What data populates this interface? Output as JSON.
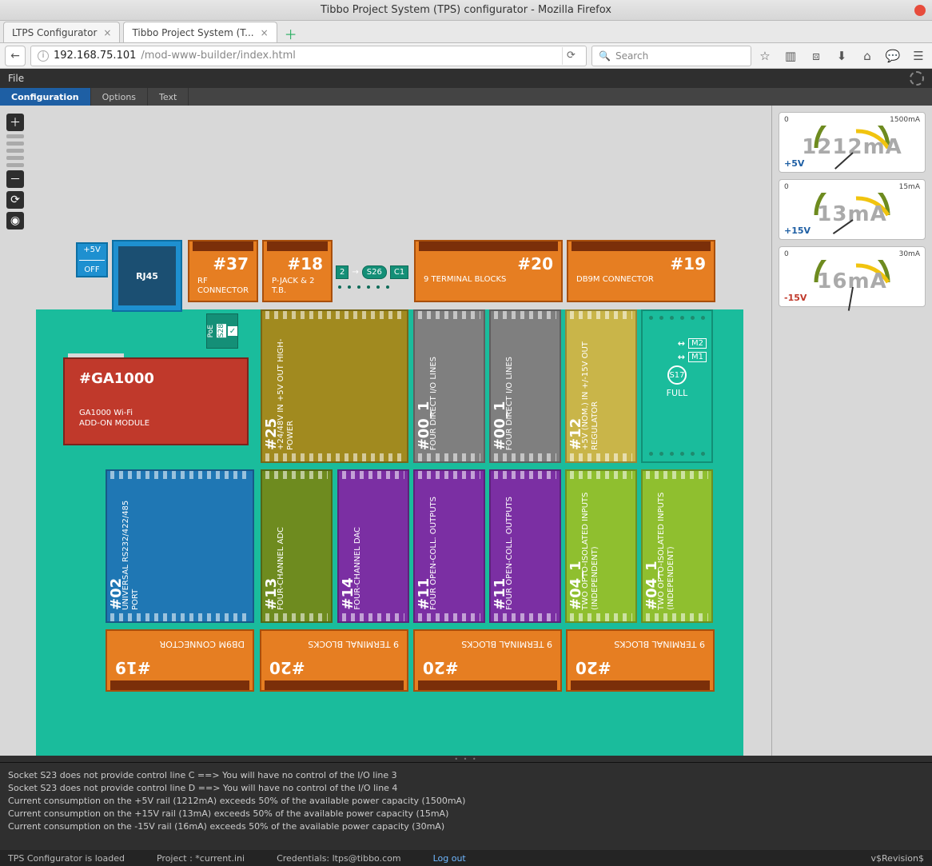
{
  "window": {
    "title": "Tibbo Project System (TPS) configurator - Mozilla Firefox"
  },
  "tabs": [
    {
      "label": "LTPS Configurator"
    },
    {
      "label": "Tibbo Project System (T..."
    }
  ],
  "url": {
    "host": "192.168.75.101",
    "path": "/mod-www-builder/index.html"
  },
  "search": {
    "placeholder": "Search"
  },
  "appmenu": {
    "file": "File"
  },
  "subtabs": {
    "configuration": "Configuration",
    "options": "Options",
    "text": "Text"
  },
  "psu": {
    "top": "+5V",
    "bottom": "OFF"
  },
  "rj45": "RJ45",
  "poe": {
    "label": "PoE",
    "s": "S28"
  },
  "top_conn": {
    "c37": {
      "num": "#37",
      "lbl": "RF CONNECTOR"
    },
    "c18": {
      "num": "#18",
      "lbl": "P-JACK & 2 T.B."
    },
    "c20": {
      "num": "#20",
      "lbl": "9 TERMINAL BLOCKS"
    },
    "c19": {
      "num": "#19",
      "lbl": "DB9M CONNECTOR"
    }
  },
  "mini": {
    "s2": "2",
    "s26": "S26",
    "c1": "C1"
  },
  "ga": {
    "h": "#GA1000",
    "d1": "GA1000 Wi-Fi",
    "d2": "ADD-ON MODULE"
  },
  "mid": {
    "m25": {
      "num": "#25",
      "lbl": "+24/48V IN +5V OUT HIGH-POWER"
    },
    "m00a": {
      "num": "#00_1",
      "lbl": "FOUR DIRECT I/O LINES"
    },
    "m00b": {
      "num": "#00_1",
      "lbl": "FOUR DIRECT I/O LINES"
    },
    "m12": {
      "num": "#12",
      "lbl": "+5V (NOM.) IN +/-15V OUT REGULATOR"
    }
  },
  "green": {
    "m2": "M2",
    "m1": "M1",
    "s17": "S17",
    "full": "FULL"
  },
  "lower": {
    "l02": {
      "num": "#02",
      "lbl": "UNIVERSAL RS232/422/485 PORT"
    },
    "l13": {
      "num": "#13",
      "lbl": "FOUR-CHANNEL ADC"
    },
    "l14": {
      "num": "#14",
      "lbl": "FOUR-CHANNEL DAC"
    },
    "l11a": {
      "num": "#11",
      "lbl": "FOUR OPEN-COLL. OUTPUTS"
    },
    "l11b": {
      "num": "#11",
      "lbl": "FOUR OPEN-COLL. OUTPUTS"
    },
    "l04a": {
      "num": "#04_1",
      "lbl": "TWO OPTO-ISOLATED INPUTS (INDEPENDENT)"
    },
    "l04b": {
      "num": "#04_1",
      "lbl": "TWO OPTO-ISOLATED INPUTS (INDEPENDENT)"
    }
  },
  "bottom_conn": {
    "b19": {
      "num": "#19",
      "lbl": "DB9M CONNECTOR"
    },
    "b20a": {
      "num": "#20",
      "lbl": "9 TERMINAL BLOCKS"
    },
    "b20b": {
      "num": "#20",
      "lbl": "9 TERMINAL BLOCKS"
    },
    "b20c": {
      "num": "#20",
      "lbl": "9 TERMINAL BLOCKS"
    }
  },
  "gauges": {
    "g1": {
      "min": "0",
      "max": "1500mA",
      "value": "1212mA",
      "rail": "+5V"
    },
    "g2": {
      "min": "0",
      "max": "15mA",
      "value": "13mA",
      "rail": "+15V"
    },
    "g3": {
      "min": "0",
      "max": "30mA",
      "value": "16mA",
      "rail": "-15V"
    }
  },
  "log": {
    "l1": "Socket S23 does not provide control line C ==> You will have no control of the I/O line 3",
    "l2": "Socket S23 does not provide control line D ==> You will have no control of the I/O line 4",
    "l3": "Current consumption on the +5V rail (1212mA) exceeds 50% of the available power capacity (1500mA)",
    "l4": "Current consumption on the +15V rail (13mA) exceeds 50% of the available power capacity (15mA)",
    "l5": "Current consumption on the -15V rail (16mA) exceeds 50% of the available power capacity (30mA)"
  },
  "status": {
    "left": "TPS Configurator is loaded",
    "project": "Project :  *current.ini",
    "cred": "Credentials: ltps@tibbo.com",
    "logout": "Log out",
    "rev": "v$Revision$"
  }
}
